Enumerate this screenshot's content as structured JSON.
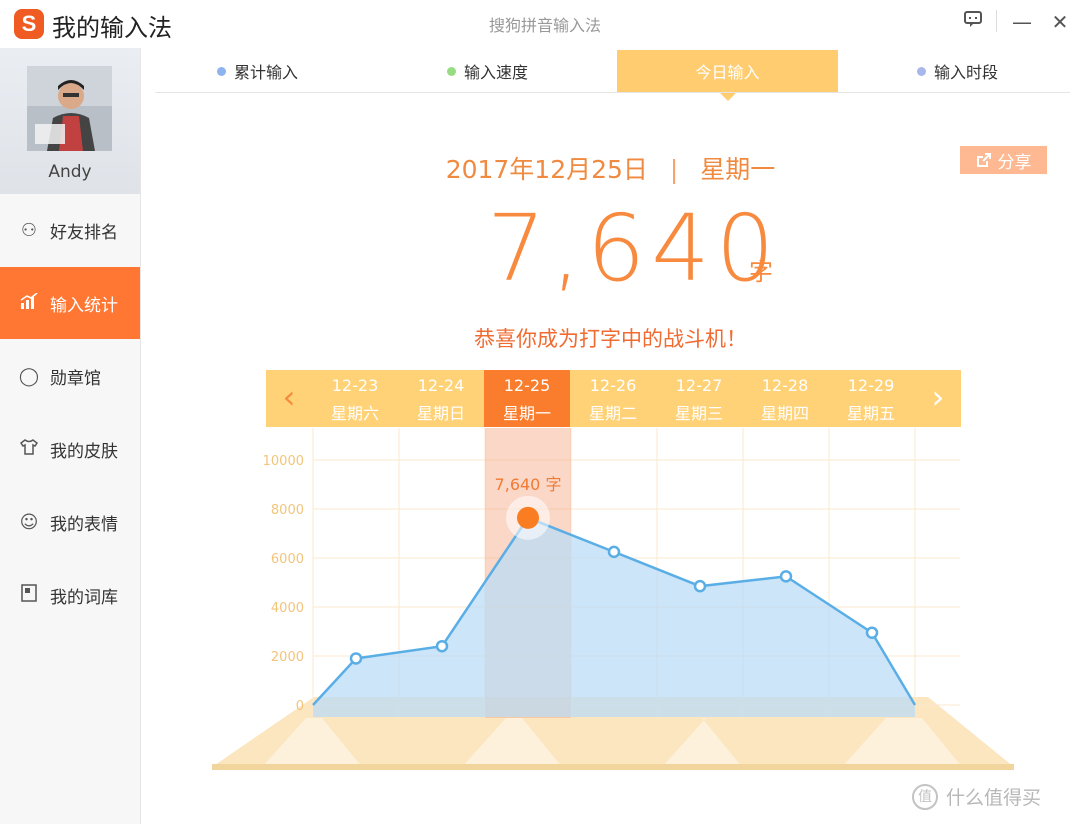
{
  "app": {
    "logo_letter": "S",
    "title": "我的输入法",
    "window_subtitle": "搜狗拼音输入法"
  },
  "titlebar": {
    "feedback_icon": "feedback-icon",
    "minimize_label": "—",
    "close_label": "✕"
  },
  "sidebar": {
    "user_name": "Andy",
    "items": [
      {
        "label": "好友排名",
        "icon": "friends-icon",
        "glyph": "⚇"
      },
      {
        "label": "输入统计",
        "icon": "stats-icon",
        "glyph": "📶"
      },
      {
        "label": "勋章馆",
        "icon": "medal-icon",
        "glyph": "◯"
      },
      {
        "label": "我的皮肤",
        "icon": "shirt-icon",
        "glyph": "👕"
      },
      {
        "label": "我的表情",
        "icon": "smiley-icon",
        "glyph": "☺"
      },
      {
        "label": "我的词库",
        "icon": "book-icon",
        "glyph": "▣"
      }
    ],
    "active_index": 1
  },
  "tabs": [
    {
      "label": "累计输入",
      "dot_color": "#8fb3ef"
    },
    {
      "label": "输入速度",
      "dot_color": "#97dc83"
    },
    {
      "label": "今日输入",
      "dot_color": ""
    },
    {
      "label": "输入时段",
      "dot_color": "#a9b6ec"
    }
  ],
  "active_tab_index": 2,
  "summary": {
    "date": "2017年12月25日",
    "separator": "|",
    "weekday": "星期一",
    "count": "7,640",
    "unit": "字",
    "message": "恭喜你成为打字中的战斗机！",
    "share_label": "分享"
  },
  "date_strip": {
    "prev_glyph": "‹",
    "next_glyph": "›",
    "days": [
      {
        "date": "12-23",
        "weekday": "星期六"
      },
      {
        "date": "12-24",
        "weekday": "星期日"
      },
      {
        "date": "12-25",
        "weekday": "星期一"
      },
      {
        "date": "12-26",
        "weekday": "星期二"
      },
      {
        "date": "12-27",
        "weekday": "星期三"
      },
      {
        "date": "12-28",
        "weekday": "星期四"
      },
      {
        "date": "12-29",
        "weekday": "星期五"
      }
    ],
    "selected_index": 2
  },
  "chart_data": {
    "type": "area",
    "categories": [
      "12-23",
      "12-24",
      "12-25",
      "12-26",
      "12-27",
      "12-28",
      "12-29"
    ],
    "values": [
      1900,
      2400,
      7640,
      6250,
      4850,
      5250,
      2950
    ],
    "edge_values": [
      0,
      0
    ],
    "ylim": [
      0,
      10000
    ],
    "yticks": [
      "10000",
      "8000",
      "6000",
      "4000",
      "2000",
      "0"
    ],
    "highlight_index": 2,
    "highlight_label": "7,640 字",
    "grid": true,
    "colors": {
      "line": "#5aaee6",
      "fill": "#bcdcf5",
      "point": "#5aaee6",
      "highlight": "#fb7d22",
      "tick": "#f3c47a",
      "grid": "#fbe8cf"
    }
  },
  "watermark": {
    "text": "什么值得买",
    "glyph": "值"
  },
  "colors": {
    "accent": "#ff7733",
    "tab_active": "#ffcc70",
    "strip": "#ffd277"
  }
}
